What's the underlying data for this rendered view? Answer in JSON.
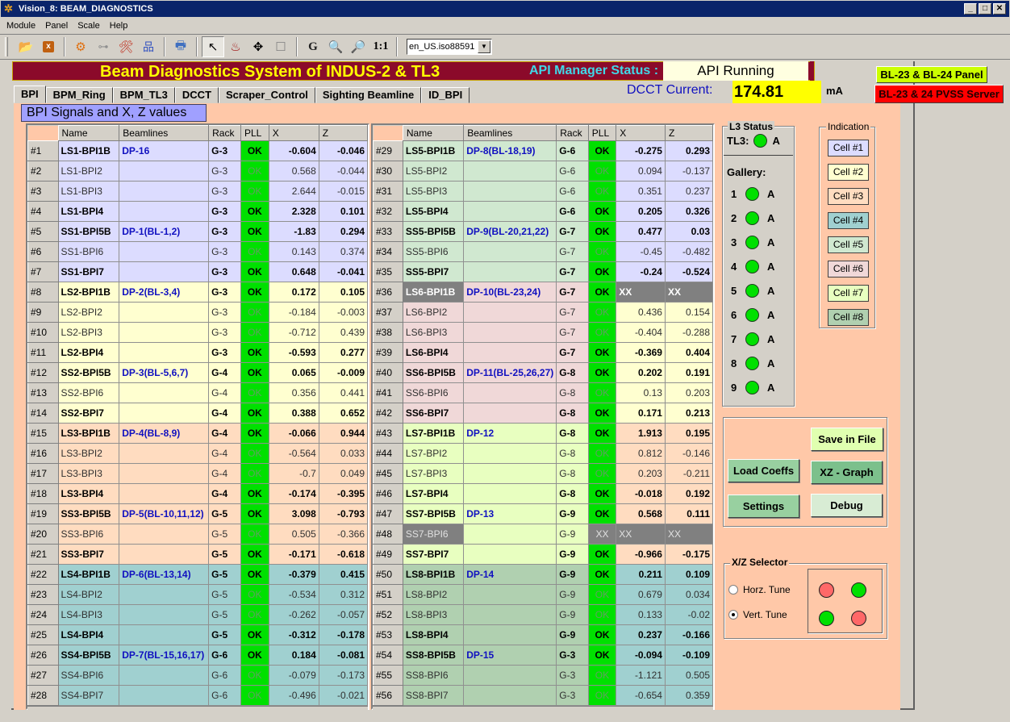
{
  "window": {
    "title": "Vision_8: BEAM_DIAGNOSTICS",
    "controls": [
      "minimize",
      "maximize",
      "close"
    ]
  },
  "menu": [
    "Module",
    "Panel",
    "Scale",
    "Help"
  ],
  "toolbar": {
    "icons": [
      "open-folder-icon",
      "close-panel-icon",
      "run-gear-icon",
      "tree-view-icon",
      "tools-icon",
      "hierarchy-icon",
      "print-icon",
      "select-pointer-icon",
      "marker-icon",
      "move-icon",
      "rectangle-icon",
      "grid-icon",
      "zoom-in-icon",
      "zoom-out-icon"
    ],
    "zoom_reset_label": "1:1",
    "locale": "en_US.iso88591"
  },
  "header": {
    "title": "Beam Diagnostics System of INDUS-2 & TL3",
    "api_label": "API Manager Status :",
    "api_status": "API Running",
    "dcct_label": "DCCT Current:",
    "dcct_value": "174.81",
    "dcct_unit": "mA",
    "bl_panel_button": "BL-23 & BL-24 Panel",
    "pvss_button": "BL-23 & 24 PVSS Server"
  },
  "tabs": [
    {
      "label": "BPI",
      "active": true
    },
    {
      "label": "BPM_Ring",
      "active": false
    },
    {
      "label": "BPM_TL3",
      "active": false
    },
    {
      "label": "DCCT",
      "active": false
    },
    {
      "label": "Scraper_Control",
      "active": false
    },
    {
      "label": "Sighting Beamline",
      "active": false
    },
    {
      "label": "ID_BPI",
      "active": false
    }
  ],
  "section_title": "BPI Signals and X, Z values",
  "table_headers": [
    "Name",
    "Beamlines",
    "Rack",
    "PLL",
    "X",
    "Z"
  ],
  "cell_colors": {
    "1": "#dcdcff",
    "2": "#ffffd0",
    "3": "#ffdcc0",
    "4": "#a0d0d0",
    "5": "#d0e8d0",
    "6": "#f0d8d8",
    "7": "#e8ffc0",
    "8": "#b0d0b0"
  },
  "left_table": [
    {
      "idx": "#1",
      "name": "LS1-BPI1B",
      "beamline": "DP-16",
      "rack": "G-3",
      "pll": "OK",
      "x": "-0.604",
      "z": "-0.046",
      "bold": true,
      "cell": 1
    },
    {
      "idx": "#2",
      "name": "LS1-BPI2",
      "beamline": "",
      "rack": "G-3",
      "pll": "OK",
      "x": "0.568",
      "z": "-0.044",
      "bold": false,
      "cell": 1
    },
    {
      "idx": "#3",
      "name": "LS1-BPI3",
      "beamline": "",
      "rack": "G-3",
      "pll": "OK",
      "x": "2.644",
      "z": "-0.015",
      "bold": false,
      "cell": 1
    },
    {
      "idx": "#4",
      "name": "LS1-BPI4",
      "beamline": "",
      "rack": "G-3",
      "pll": "OK",
      "x": "2.328",
      "z": "0.101",
      "bold": true,
      "cell": 1
    },
    {
      "idx": "#5",
      "name": "SS1-BPI5B",
      "beamline": "DP-1(BL-1,2)",
      "rack": "G-3",
      "pll": "OK",
      "x": "-1.83",
      "z": "0.294",
      "bold": true,
      "cell": 1
    },
    {
      "idx": "#6",
      "name": "SS1-BPI6",
      "beamline": "",
      "rack": "G-3",
      "pll": "OK",
      "x": "0.143",
      "z": "0.374",
      "bold": false,
      "cell": 1
    },
    {
      "idx": "#7",
      "name": "SS1-BPI7",
      "beamline": "",
      "rack": "G-3",
      "pll": "OK",
      "x": "0.648",
      "z": "-0.041",
      "bold": true,
      "cell": 1
    },
    {
      "idx": "#8",
      "name": "LS2-BPI1B",
      "beamline": "DP-2(BL-3,4)",
      "rack": "G-3",
      "pll": "OK",
      "x": "0.172",
      "z": "0.105",
      "bold": true,
      "cell": 2
    },
    {
      "idx": "#9",
      "name": "LS2-BPI2",
      "beamline": "",
      "rack": "G-3",
      "pll": "OK",
      "x": "-0.184",
      "z": "-0.003",
      "bold": false,
      "cell": 2
    },
    {
      "idx": "#10",
      "name": "LS2-BPI3",
      "beamline": "",
      "rack": "G-3",
      "pll": "OK",
      "x": "-0.712",
      "z": "0.439",
      "bold": false,
      "cell": 2
    },
    {
      "idx": "#11",
      "name": "LS2-BPI4",
      "beamline": "",
      "rack": "G-3",
      "pll": "OK",
      "x": "-0.593",
      "z": "0.277",
      "bold": true,
      "cell": 2
    },
    {
      "idx": "#12",
      "name": "SS2-BPI5B",
      "beamline": "DP-3(BL-5,6,7)",
      "rack": "G-4",
      "pll": "OK",
      "x": "0.065",
      "z": "-0.009",
      "bold": true,
      "cell": 2
    },
    {
      "idx": "#13",
      "name": "SS2-BPI6",
      "beamline": "",
      "rack": "G-4",
      "pll": "OK",
      "x": "0.356",
      "z": "0.441",
      "bold": false,
      "cell": 2
    },
    {
      "idx": "#14",
      "name": "SS2-BPI7",
      "beamline": "",
      "rack": "G-4",
      "pll": "OK",
      "x": "0.388",
      "z": "0.652",
      "bold": true,
      "cell": 2
    },
    {
      "idx": "#15",
      "name": "LS3-BPI1B",
      "beamline": "DP-4(BL-8,9)",
      "rack": "G-4",
      "pll": "OK",
      "x": "-0.066",
      "z": "0.944",
      "bold": true,
      "cell": 3
    },
    {
      "idx": "#16",
      "name": "LS3-BPI2",
      "beamline": "",
      "rack": "G-4",
      "pll": "OK",
      "x": "-0.564",
      "z": "0.033",
      "bold": false,
      "cell": 3
    },
    {
      "idx": "#17",
      "name": "LS3-BPI3",
      "beamline": "",
      "rack": "G-4",
      "pll": "OK",
      "x": "-0.7",
      "z": "0.049",
      "bold": false,
      "cell": 3
    },
    {
      "idx": "#18",
      "name": "LS3-BPI4",
      "beamline": "",
      "rack": "G-4",
      "pll": "OK",
      "x": "-0.174",
      "z": "-0.395",
      "bold": true,
      "cell": 3
    },
    {
      "idx": "#19",
      "name": "SS3-BPI5B",
      "beamline": "DP-5(BL-10,11,12)",
      "rack": "G-5",
      "pll": "OK",
      "x": "3.098",
      "z": "-0.793",
      "bold": true,
      "cell": 3
    },
    {
      "idx": "#20",
      "name": "SS3-BPI6",
      "beamline": "",
      "rack": "G-5",
      "pll": "OK",
      "x": "0.505",
      "z": "-0.366",
      "bold": false,
      "cell": 3
    },
    {
      "idx": "#21",
      "name": "SS3-BPI7",
      "beamline": "",
      "rack": "G-5",
      "pll": "OK",
      "x": "-0.171",
      "z": "-0.618",
      "bold": true,
      "cell": 3
    },
    {
      "idx": "#22",
      "name": "LS4-BPI1B",
      "beamline": "DP-6(BL-13,14)",
      "rack": "G-5",
      "pll": "OK",
      "x": "-0.379",
      "z": "0.415",
      "bold": true,
      "cell": 4
    },
    {
      "idx": "#23",
      "name": "LS4-BPI2",
      "beamline": "",
      "rack": "G-5",
      "pll": "OK",
      "x": "-0.534",
      "z": "0.312",
      "bold": false,
      "cell": 4
    },
    {
      "idx": "#24",
      "name": "LS4-BPI3",
      "beamline": "",
      "rack": "G-5",
      "pll": "OK",
      "x": "-0.262",
      "z": "-0.057",
      "bold": false,
      "cell": 4
    },
    {
      "idx": "#25",
      "name": "LS4-BPI4",
      "beamline": "",
      "rack": "G-5",
      "pll": "OK",
      "x": "-0.312",
      "z": "-0.178",
      "bold": true,
      "cell": 4
    },
    {
      "idx": "#26",
      "name": "SS4-BPI5B",
      "beamline": "DP-7(BL-15,16,17)",
      "rack": "G-6",
      "pll": "OK",
      "x": "0.184",
      "z": "-0.081",
      "bold": true,
      "cell": 4
    },
    {
      "idx": "#27",
      "name": "SS4-BPI6",
      "beamline": "",
      "rack": "G-6",
      "pll": "OK",
      "x": "-0.079",
      "z": "-0.173",
      "bold": false,
      "cell": 4
    },
    {
      "idx": "#28",
      "name": "SS4-BPI7",
      "beamline": "",
      "rack": "G-6",
      "pll": "OK",
      "x": "-0.496",
      "z": "-0.021",
      "bold": false,
      "cell": 4
    }
  ],
  "right_table": [
    {
      "idx": "#29",
      "name": "LS5-BPI1B",
      "beamline": "DP-8(BL-18,19)",
      "rack": "G-6",
      "pll": "OK",
      "x": "-0.275",
      "z": "0.293",
      "bold": true,
      "cell": 5,
      "xz_cell": 1
    },
    {
      "idx": "#30",
      "name": "LS5-BPI2",
      "beamline": "",
      "rack": "G-6",
      "pll": "OK",
      "x": "0.094",
      "z": "-0.137",
      "bold": false,
      "cell": 5,
      "xz_cell": 1
    },
    {
      "idx": "#31",
      "name": "LS5-BPI3",
      "beamline": "",
      "rack": "G-6",
      "pll": "OK",
      "x": "0.351",
      "z": "0.237",
      "bold": false,
      "cell": 5,
      "xz_cell": 1
    },
    {
      "idx": "#32",
      "name": "LS5-BPI4",
      "beamline": "",
      "rack": "G-6",
      "pll": "OK",
      "x": "0.205",
      "z": "0.326",
      "bold": true,
      "cell": 5,
      "xz_cell": 1
    },
    {
      "idx": "#33",
      "name": "SS5-BPI5B",
      "beamline": "DP-9(BL-20,21,22)",
      "rack": "G-7",
      "pll": "OK",
      "x": "0.477",
      "z": "0.03",
      "bold": true,
      "cell": 5,
      "xz_cell": 1
    },
    {
      "idx": "#34",
      "name": "SS5-BPI6",
      "beamline": "",
      "rack": "G-7",
      "pll": "OK",
      "x": "-0.45",
      "z": "-0.482",
      "bold": false,
      "cell": 5,
      "xz_cell": 1
    },
    {
      "idx": "#35",
      "name": "SS5-BPI7",
      "beamline": "",
      "rack": "G-7",
      "pll": "OK",
      "x": "-0.24",
      "z": "-0.524",
      "bold": true,
      "cell": 5,
      "xz_cell": 1
    },
    {
      "idx": "#36",
      "name": "LS6-BPI1B",
      "beamline": "DP-10(BL-23,24)",
      "rack": "G-7",
      "pll": "OK",
      "x": "XX",
      "z": "XX",
      "bold": true,
      "cell": 6,
      "xz_cell": 2,
      "dead_name": true,
      "dead_xz": true
    },
    {
      "idx": "#37",
      "name": "LS6-BPI2",
      "beamline": "",
      "rack": "G-7",
      "pll": "OK",
      "x": "0.436",
      "z": "0.154",
      "bold": false,
      "cell": 6,
      "xz_cell": 2
    },
    {
      "idx": "#38",
      "name": "LS6-BPI3",
      "beamline": "",
      "rack": "G-7",
      "pll": "OK",
      "x": "-0.404",
      "z": "-0.288",
      "bold": false,
      "cell": 6,
      "xz_cell": 2
    },
    {
      "idx": "#39",
      "name": "LS6-BPI4",
      "beamline": "",
      "rack": "G-7",
      "pll": "OK",
      "x": "-0.369",
      "z": "0.404",
      "bold": true,
      "cell": 6,
      "xz_cell": 2
    },
    {
      "idx": "#40",
      "name": "SS6-BPI5B",
      "beamline": "DP-11(BL-25,26,27)",
      "rack": "G-8",
      "pll": "OK",
      "x": "0.202",
      "z": "0.191",
      "bold": true,
      "cell": 6,
      "xz_cell": 2
    },
    {
      "idx": "#41",
      "name": "SS6-BPI6",
      "beamline": "",
      "rack": "G-8",
      "pll": "OK",
      "x": "0.13",
      "z": "0.203",
      "bold": false,
      "cell": 6,
      "xz_cell": 2
    },
    {
      "idx": "#42",
      "name": "SS6-BPI7",
      "beamline": "",
      "rack": "G-8",
      "pll": "OK",
      "x": "0.171",
      "z": "0.213",
      "bold": true,
      "cell": 6,
      "xz_cell": 2
    },
    {
      "idx": "#43",
      "name": "LS7-BPI1B",
      "beamline": "DP-12",
      "rack": "G-8",
      "pll": "OK",
      "x": "1.913",
      "z": "0.195",
      "bold": true,
      "cell": 7,
      "xz_cell": 3
    },
    {
      "idx": "#44",
      "name": "LS7-BPI2",
      "beamline": "",
      "rack": "G-8",
      "pll": "OK",
      "x": "0.812",
      "z": "-0.146",
      "bold": false,
      "cell": 7,
      "xz_cell": 3
    },
    {
      "idx": "#45",
      "name": "LS7-BPI3",
      "beamline": "",
      "rack": "G-8",
      "pll": "OK",
      "x": "0.203",
      "z": "-0.211",
      "bold": false,
      "cell": 7,
      "xz_cell": 3
    },
    {
      "idx": "#46",
      "name": "LS7-BPI4",
      "beamline": "",
      "rack": "G-8",
      "pll": "OK",
      "x": "-0.018",
      "z": "0.192",
      "bold": true,
      "cell": 7,
      "xz_cell": 3
    },
    {
      "idx": "#47",
      "name": "SS7-BPI5B",
      "beamline": "DP-13",
      "rack": "G-9",
      "pll": "OK",
      "x": "0.568",
      "z": "0.111",
      "bold": true,
      "cell": 7,
      "xz_cell": 3
    },
    {
      "idx": "#48",
      "name": "SS7-BPI6",
      "beamline": "",
      "rack": "G-9",
      "pll": "XX",
      "x": "XX",
      "z": "XX",
      "bold": false,
      "cell": 7,
      "xz_cell": 3,
      "dead_name": true,
      "dead_pll": true,
      "dead_xz": true
    },
    {
      "idx": "#49",
      "name": "SS7-BPI7",
      "beamline": "",
      "rack": "G-9",
      "pll": "OK",
      "x": "-0.966",
      "z": "-0.175",
      "bold": true,
      "cell": 7,
      "xz_cell": 3
    },
    {
      "idx": "#50",
      "name": "LS8-BPI1B",
      "beamline": "DP-14",
      "rack": "G-9",
      "pll": "OK",
      "x": "0.211",
      "z": "0.109",
      "bold": true,
      "cell": 8,
      "xz_cell": 4
    },
    {
      "idx": "#51",
      "name": "LS8-BPI2",
      "beamline": "",
      "rack": "G-9",
      "pll": "OK",
      "x": "0.679",
      "z": "0.034",
      "bold": false,
      "cell": 8,
      "xz_cell": 4
    },
    {
      "idx": "#52",
      "name": "LS8-BPI3",
      "beamline": "",
      "rack": "G-9",
      "pll": "OK",
      "x": "0.133",
      "z": "-0.02",
      "bold": false,
      "cell": 8,
      "xz_cell": 4
    },
    {
      "idx": "#53",
      "name": "LS8-BPI4",
      "beamline": "",
      "rack": "G-9",
      "pll": "OK",
      "x": "0.237",
      "z": "-0.166",
      "bold": true,
      "cell": 8,
      "xz_cell": 4
    },
    {
      "idx": "#54",
      "name": "SS8-BPI5B",
      "beamline": "DP-15",
      "rack": "G-3",
      "pll": "OK",
      "x": "-0.094",
      "z": "-0.109",
      "bold": true,
      "cell": 8,
      "xz_cell": 4
    },
    {
      "idx": "#55",
      "name": "SS8-BPI6",
      "beamline": "",
      "rack": "G-3",
      "pll": "OK",
      "x": "-1.121",
      "z": "0.505",
      "bold": false,
      "cell": 8,
      "xz_cell": 4
    },
    {
      "idx": "#56",
      "name": "SS8-BPI7",
      "beamline": "",
      "rack": "G-3",
      "pll": "OK",
      "x": "-0.654",
      "z": "0.359",
      "bold": false,
      "cell": 8,
      "xz_cell": 4
    }
  ],
  "l3_status": {
    "title": "L3 Status",
    "tl3_label": "TL3:",
    "tl3_state": "A",
    "tl3_led": "green",
    "gallery_label": "Gallery:",
    "gallery": [
      {
        "num": "1",
        "led": "green",
        "state": "A"
      },
      {
        "num": "2",
        "led": "green",
        "state": "A"
      },
      {
        "num": "3",
        "led": "green",
        "state": "A"
      },
      {
        "num": "4",
        "led": "green",
        "state": "A"
      },
      {
        "num": "5",
        "led": "green",
        "state": "A"
      },
      {
        "num": "6",
        "led": "green",
        "state": "A"
      },
      {
        "num": "7",
        "led": "green",
        "state": "A"
      },
      {
        "num": "8",
        "led": "green",
        "state": "A"
      },
      {
        "num": "9",
        "led": "green",
        "state": "A"
      }
    ]
  },
  "indication": {
    "title": "Indication",
    "cells": [
      "Cell #1",
      "Cell #2",
      "Cell #3",
      "Cell #4",
      "Cell #5",
      "Cell #6",
      "Cell #7",
      "Cell #8"
    ]
  },
  "actions": {
    "save_in_file": "Save in File",
    "load_coeffs": "Load Coeffs",
    "xz_graph": "XZ - Graph",
    "settings": "Settings",
    "debug": "Debug"
  },
  "xz_selector": {
    "title": "X/Z Selector",
    "options": [
      {
        "label": "Horz. Tune",
        "checked": false
      },
      {
        "label": "Vert. Tune",
        "checked": true
      }
    ],
    "leds": [
      "red",
      "green",
      "green",
      "red"
    ]
  }
}
